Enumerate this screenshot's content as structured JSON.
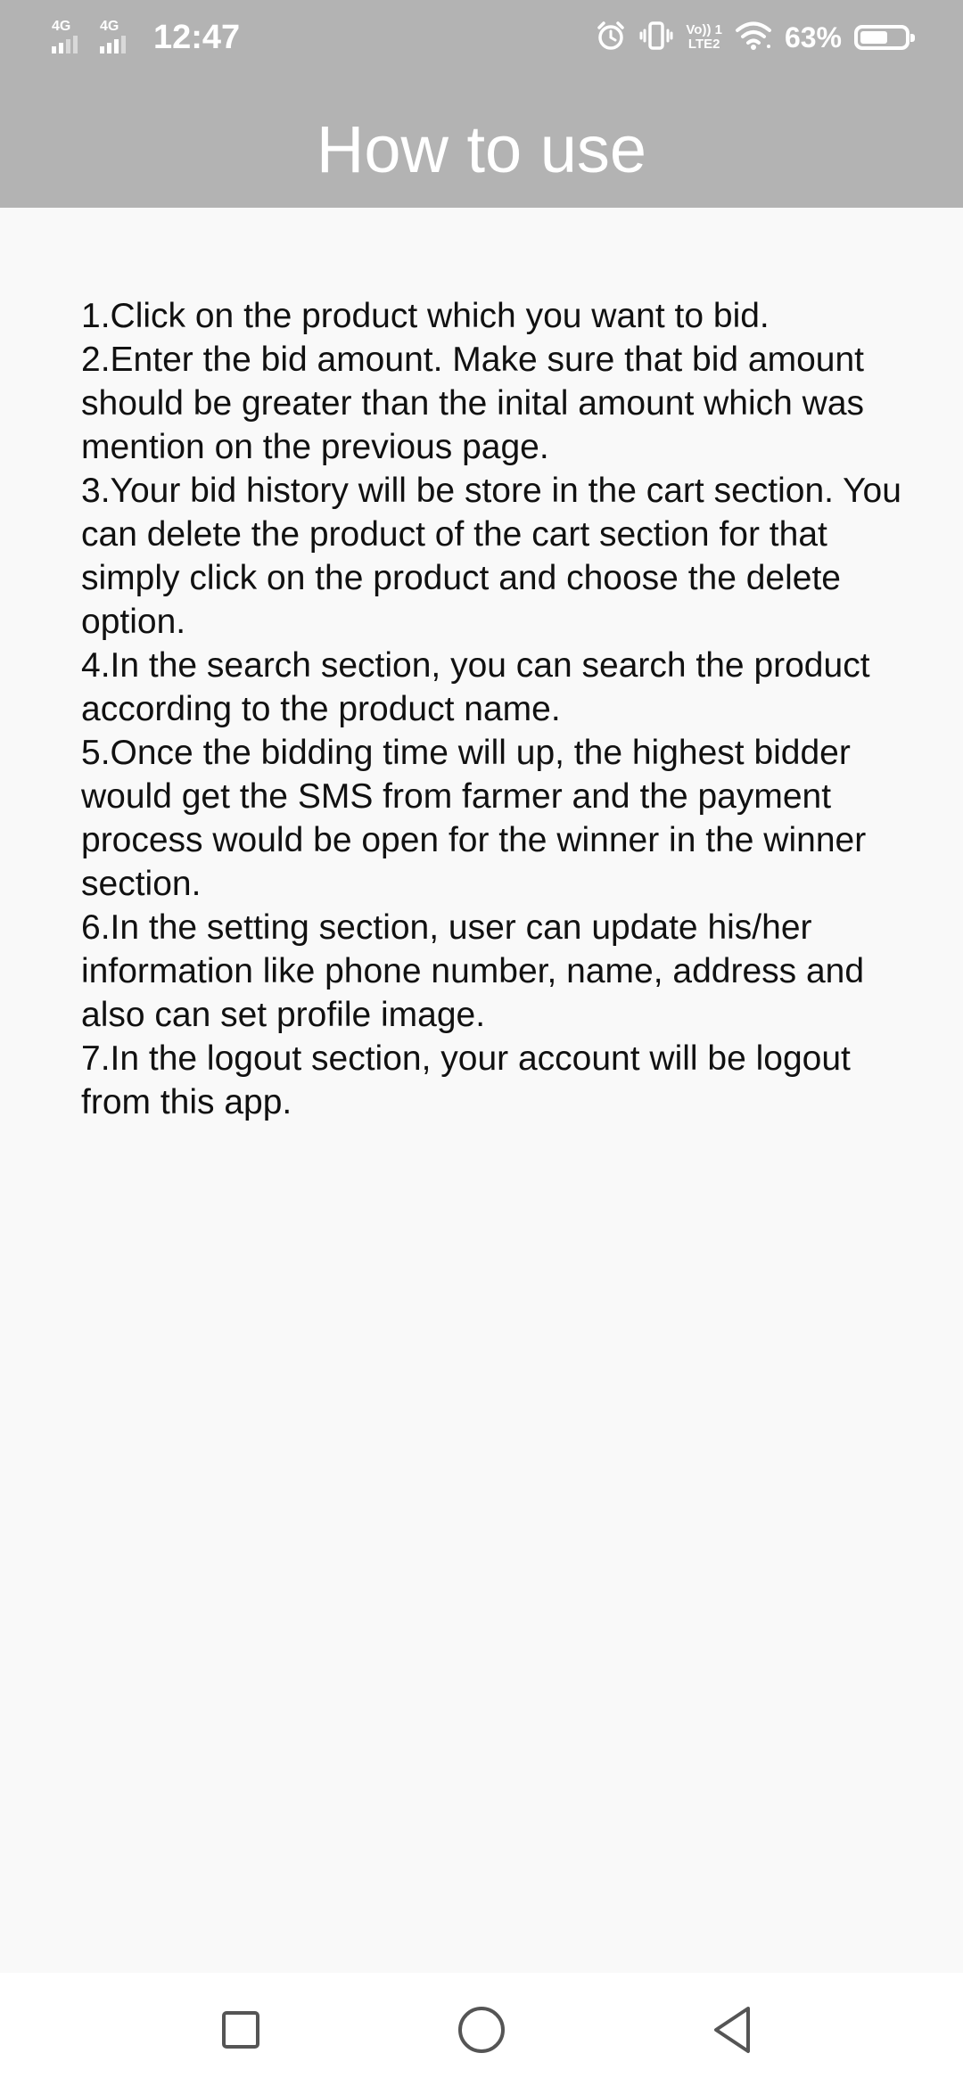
{
  "status_bar": {
    "sim1_network": "4G",
    "sim2_network": "4G",
    "time": "12:47",
    "volte_top": "Vo)) 1",
    "volte_bottom": "LTE2",
    "battery_percent": "63%",
    "battery_level": 0.63,
    "icons": [
      "alarm-icon",
      "vibrate-icon",
      "volte-icon",
      "wifi-icon",
      "battery-icon"
    ]
  },
  "header": {
    "title": "How to use",
    "background_color": "#b3b3b3"
  },
  "instructions": [
    "1.Click on the product which you want to bid.",
    "2.Enter the bid amount. Make sure that bid amount should be greater than the inital amount which was mention on the previous page.",
    "3.Your bid history will be store in the cart section. You can delete the product of the cart section for that simply click on the product and choose the delete option.",
    "4.In the search section, you can search the product according to the product name.",
    "5.Once the bidding time will up, the highest bidder would get the SMS from farmer and the payment process would be open for the winner in the winner section.",
    "6.In the setting section, user can update his/her information like phone number, name, address and also can set profile image.",
    "7.In the logout section, your account will be logout from this app."
  ],
  "nav_bar": {
    "buttons": [
      "recent-apps-icon",
      "home-icon",
      "back-icon"
    ]
  }
}
